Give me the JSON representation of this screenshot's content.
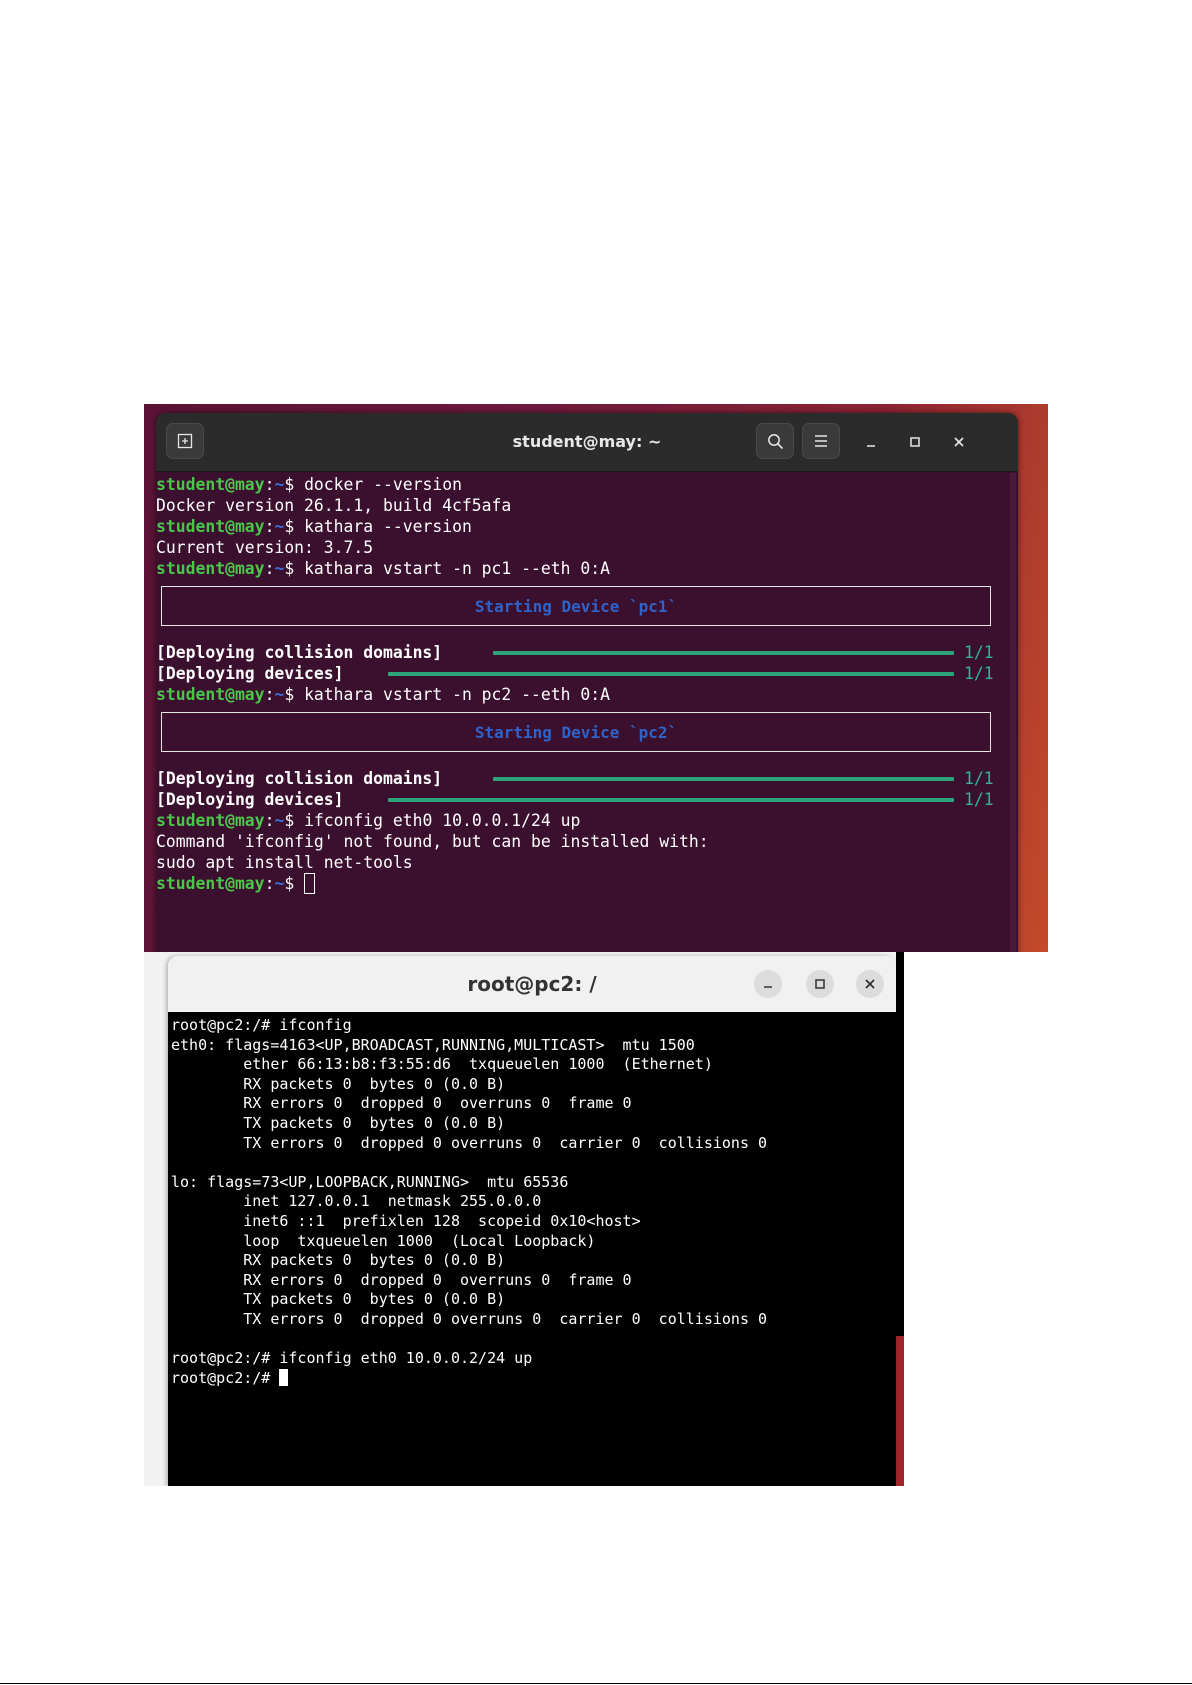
{
  "ubuntu_terminal": {
    "title": "student@may: ~",
    "prompt_user": "student@may",
    "prompt_sep": ":",
    "prompt_path": "~",
    "prompt_sign": "$ ",
    "commands": {
      "c1": "docker --version",
      "c2": "kathara --version",
      "c3": "kathara vstart -n pc1 --eth 0:A",
      "c4": "kathara vstart -n pc2 --eth 0:A",
      "c5": "ifconfig eth0 10.0.0.1/24 up"
    },
    "outputs": {
      "docker_version": "Docker version 26.1.1, build 4cf5afa",
      "kathara_version": "Current version: 3.7.5",
      "ifconfig_missing": "Command 'ifconfig' not found, but can be installed with:",
      "apt_hint": "sudo apt install net-tools"
    },
    "banners": {
      "pc1": "Starting Device `pc1`",
      "pc2": "Starting Device `pc2`"
    },
    "progress": {
      "collision_label": "[Deploying collision domains]",
      "devices_label": "[Deploying devices]",
      "count": "1/1",
      "fraction": 1.0
    }
  },
  "xterm": {
    "title": "root@pc2: /",
    "lines": [
      "root@pc2:/# ifconfig",
      "eth0: flags=4163<UP,BROADCAST,RUNNING,MULTICAST>  mtu 1500",
      "        ether 66:13:b8:f3:55:d6  txqueuelen 1000  (Ethernet)",
      "        RX packets 0  bytes 0 (0.0 B)",
      "        RX errors 0  dropped 0  overruns 0  frame 0",
      "        TX packets 0  bytes 0 (0.0 B)",
      "        TX errors 0  dropped 0 overruns 0  carrier 0  collisions 0",
      "",
      "lo: flags=73<UP,LOOPBACK,RUNNING>  mtu 65536",
      "        inet 127.0.0.1  netmask 255.0.0.0",
      "        inet6 ::1  prefixlen 128  scopeid 0x10<host>",
      "        loop  txqueuelen 1000  (Local Loopback)",
      "        RX packets 0  bytes 0 (0.0 B)",
      "        RX errors 0  dropped 0  overruns 0  frame 0",
      "        TX packets 0  bytes 0 (0.0 B)",
      "        TX errors 0  dropped 0 overruns 0  carrier 0  collisions 0",
      "",
      "root@pc2:/# ifconfig eth0 10.0.0.2/24 up",
      "root@pc2:/# "
    ]
  },
  "icons": {
    "new_tab": "new-tab-icon",
    "search": "search-icon",
    "menu": "hamburger-menu-icon",
    "minimize": "minimize-icon",
    "maximize": "maximize-icon",
    "close": "close-icon"
  }
}
